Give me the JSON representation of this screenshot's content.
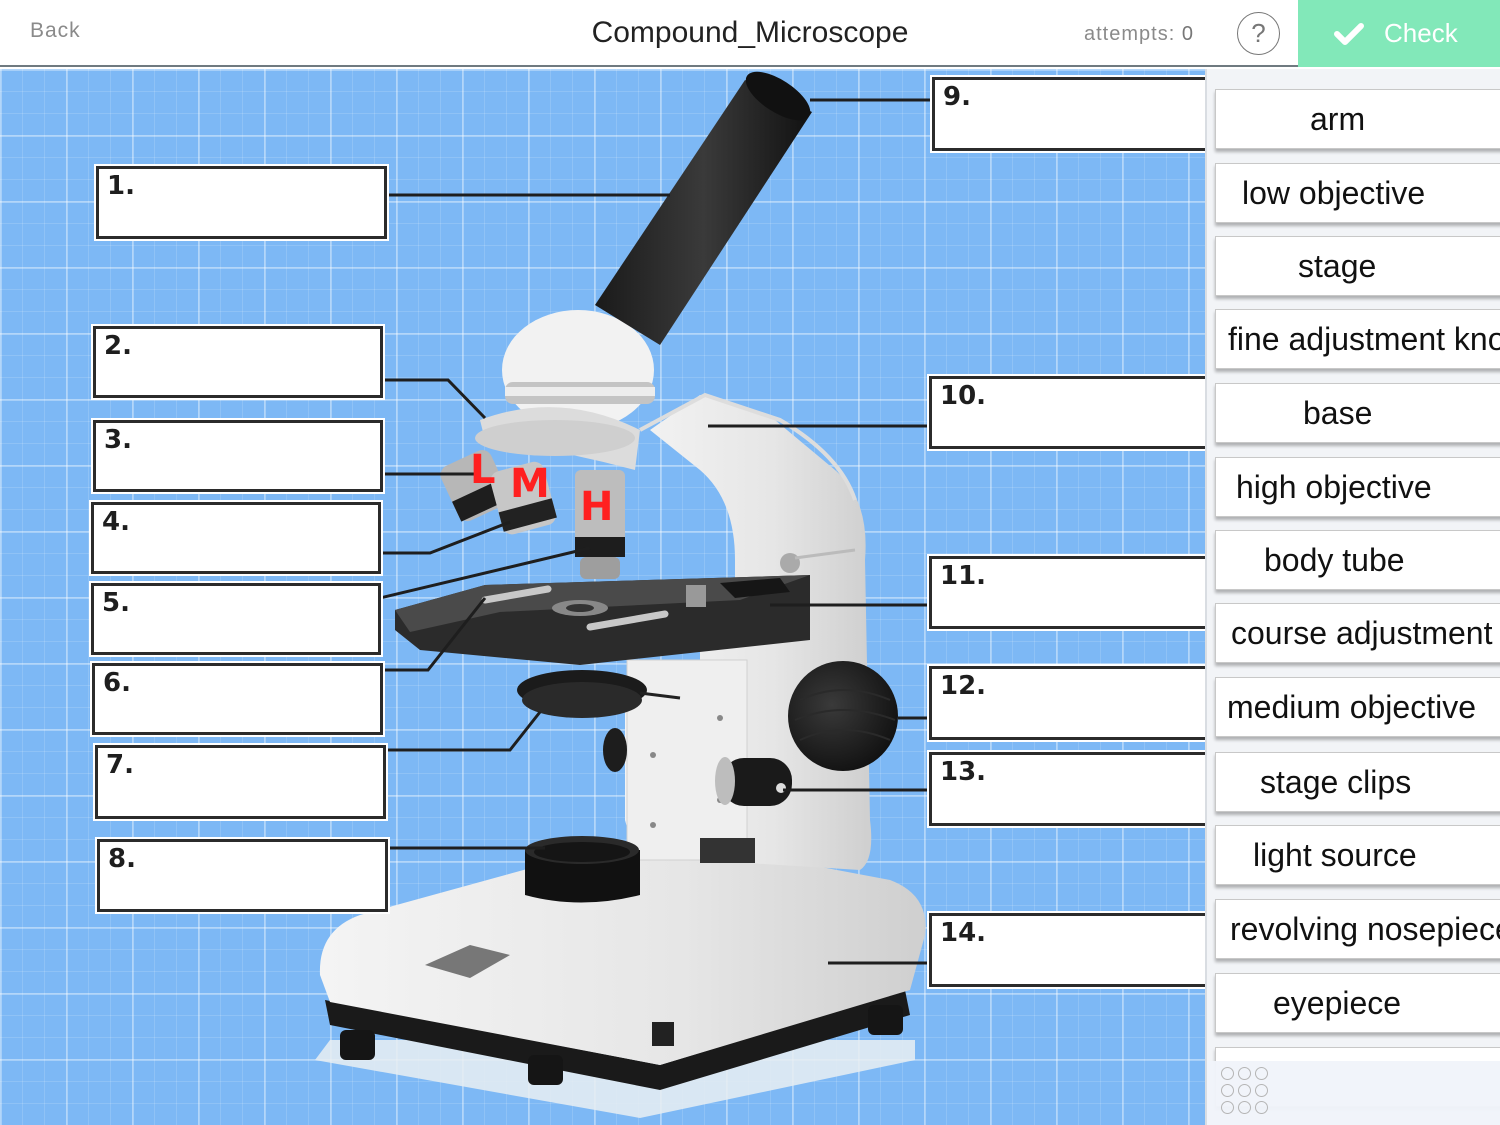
{
  "header": {
    "back_label": "Back",
    "title": "Compound_Microscope",
    "attempts_label": "attempts:",
    "attempts_count": "0",
    "help_label": "?",
    "check_label": "Check"
  },
  "colors": {
    "check_bg": "#82e8b9",
    "canvas_bg": "#7db8f5",
    "objective_letters": "#ff2020"
  },
  "diagram": {
    "objective_letters": [
      "L",
      "M",
      "H"
    ],
    "label_boxes": [
      {
        "number": "1."
      },
      {
        "number": "2."
      },
      {
        "number": "3."
      },
      {
        "number": "4."
      },
      {
        "number": "5."
      },
      {
        "number": "6."
      },
      {
        "number": "7."
      },
      {
        "number": "8."
      },
      {
        "number": "9."
      },
      {
        "number": "10."
      },
      {
        "number": "11."
      },
      {
        "number": "12."
      },
      {
        "number": "13."
      },
      {
        "number": "14."
      }
    ]
  },
  "word_bank": {
    "items": [
      {
        "label": "arm"
      },
      {
        "label": "low objective"
      },
      {
        "label": "stage"
      },
      {
        "label": "fine adjustment knob"
      },
      {
        "label": "base"
      },
      {
        "label": "high objective"
      },
      {
        "label": "body tube"
      },
      {
        "label": "course adjustment knob"
      },
      {
        "label": "medium objective"
      },
      {
        "label": "stage clips"
      },
      {
        "label": "light source"
      },
      {
        "label": "revolving nosepiece"
      },
      {
        "label": "eyepiece"
      },
      {
        "label": ""
      }
    ],
    "grid_icon": "grid-dots-icon"
  }
}
